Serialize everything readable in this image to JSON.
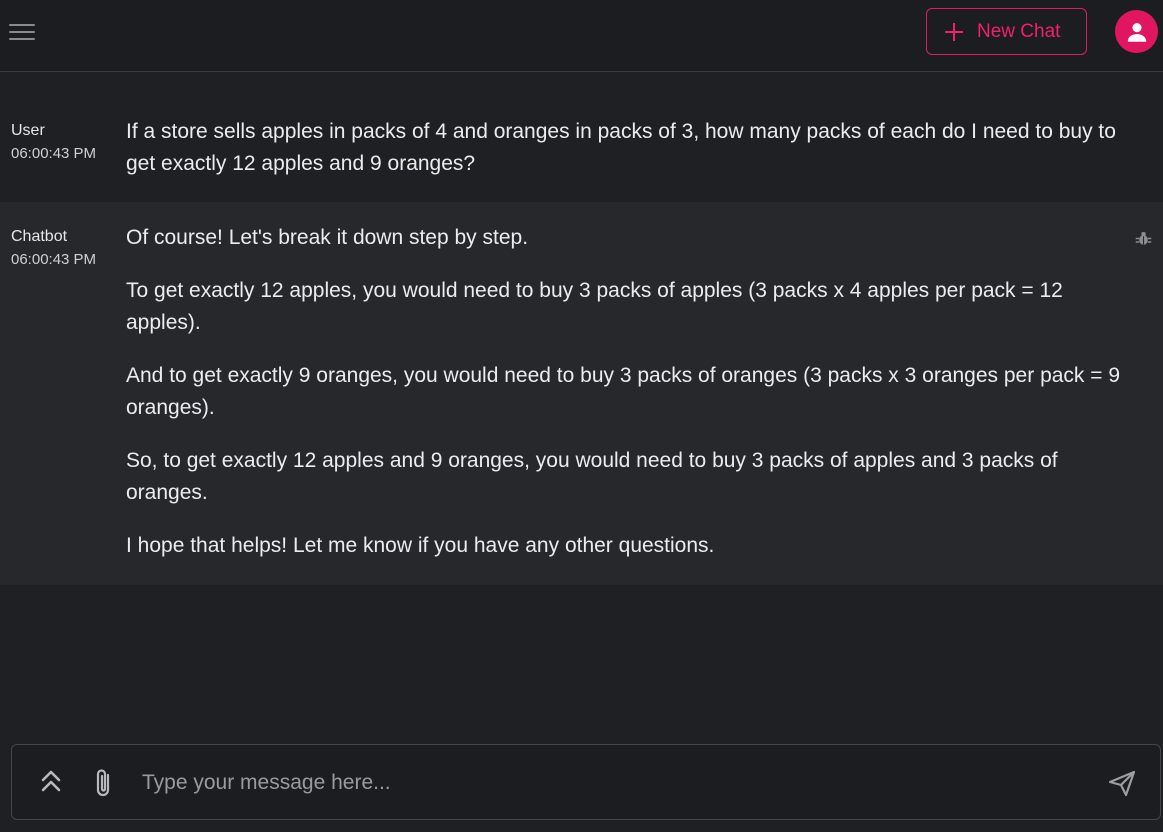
{
  "header": {
    "new_chat_label": "New Chat",
    "icons": {
      "menu": "hamburger-menu-icon",
      "new_chat": "plus-icon",
      "avatar": "user-avatar-icon"
    },
    "accent_color": "#e0175f"
  },
  "messages": [
    {
      "role": "User",
      "time": "06:00:43 PM",
      "paragraphs": [
        "If a store sells apples in packs of 4 and oranges in packs of 3, how many packs of each do I need to buy to get exactly 12 apples and 9 oranges?"
      ]
    },
    {
      "role": "Chatbot",
      "time": "06:00:43 PM",
      "paragraphs": [
        "Of course! Let's break it down step by step.",
        "To get exactly 12 apples, you would need to buy 3 packs of apples (3 packs x 4 apples per pack = 12 apples).",
        "And to get exactly 9 oranges, you would need to buy 3 packs of oranges (3 packs x 3 oranges per pack = 9 oranges).",
        "So, to get exactly 12 apples and 9 oranges, you would need to buy 3 packs of apples and 3 packs of oranges.",
        "I hope that helps! Let me know if you have any other questions."
      ],
      "debug_icon": "bug-icon"
    }
  ],
  "composer": {
    "placeholder": "Type your message here...",
    "value": "",
    "icons": {
      "expand": "chevrons-up-icon",
      "attach": "paperclip-icon",
      "send": "send-icon"
    }
  }
}
